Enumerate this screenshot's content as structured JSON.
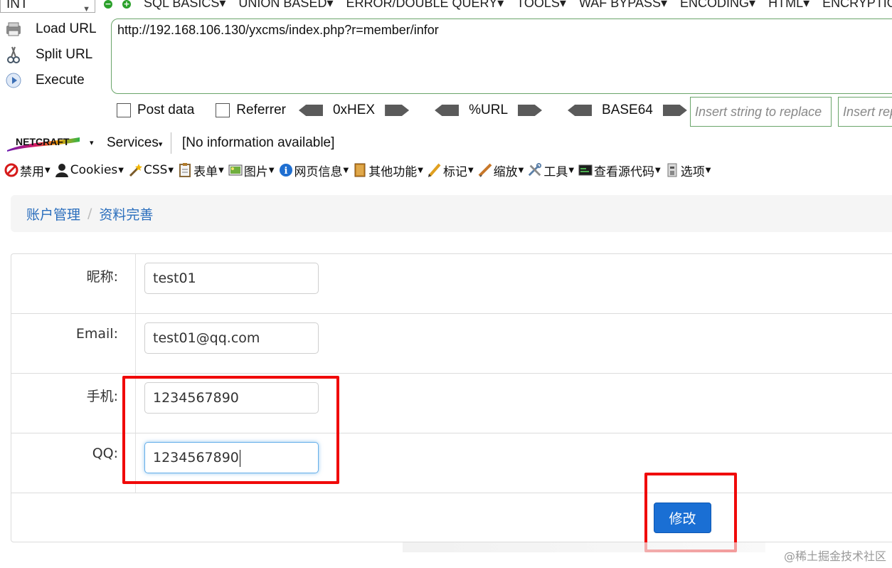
{
  "hackbar": {
    "select_value": "INT",
    "menus": [
      "SQL BASICS▾",
      "UNION BASED▾",
      "ERROR/DOUBLE QUERY▾",
      "TOOLS▾",
      "WAF BYPASS▾",
      "ENCODING▾",
      "HTML▾",
      "ENCRYPTION▾"
    ],
    "load_url": "Load URL",
    "split_url": "Split URL",
    "execute": "Execute",
    "url": "http://192.168.106.130/yxcms/index.php?r=member/infor",
    "post_data": "Post data",
    "referrer": "Referrer",
    "hex": "0xHEX",
    "url_enc": "%URL",
    "base64": "BASE64",
    "replace_placeholder": "Insert string to replace",
    "replace_with_placeholder": "Insert replacing string"
  },
  "netcraft": {
    "logo_text": "NETCRAFT",
    "services": "Services",
    "info": "[No information available]"
  },
  "devtoolbar": {
    "items": [
      {
        "label": "禁用",
        "icon": "forbidden-icon"
      },
      {
        "label": "Cookies",
        "icon": "user-icon"
      },
      {
        "label": "CSS",
        "icon": "wand-icon"
      },
      {
        "label": "表单",
        "icon": "clipboard-icon"
      },
      {
        "label": "图片",
        "icon": "image-icon"
      },
      {
        "label": "网页信息",
        "icon": "info-icon"
      },
      {
        "label": "其他功能",
        "icon": "book-icon"
      },
      {
        "label": "标记",
        "icon": "pencil-icon"
      },
      {
        "label": "缩放",
        "icon": "ruler-icon"
      },
      {
        "label": "工具",
        "icon": "tools-icon"
      },
      {
        "label": "查看源代码",
        "icon": "terminal-icon"
      },
      {
        "label": "选项",
        "icon": "options-icon"
      }
    ]
  },
  "breadcrumb": {
    "parent": "账户管理",
    "separator": "/",
    "current": "资料完善"
  },
  "form": {
    "nickname_label": "昵称:",
    "nickname_value": "test01",
    "email_label": "Email:",
    "email_value": "test01@qq.com",
    "phone_label": "手机:",
    "phone_value": "1234567890",
    "qq_label": "QQ:",
    "qq_value": "1234567890",
    "submit_label": "修改"
  },
  "watermark": "@稀土掘金技术社区",
  "colors": {
    "link": "#2a6ebd",
    "button": "#1a6fd4",
    "highlight": "#f00a0a",
    "hackbar_border": "#6aa56a"
  }
}
